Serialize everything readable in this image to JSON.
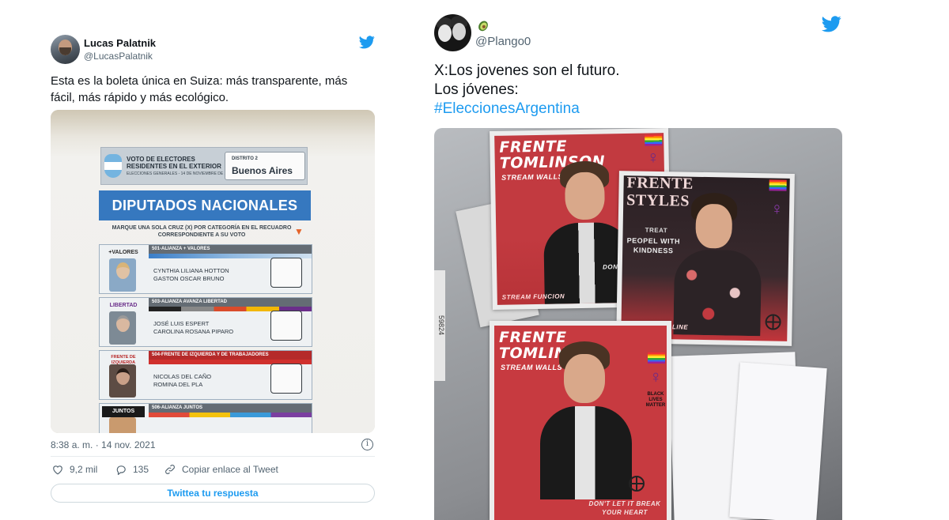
{
  "tweet_left": {
    "user_name": "Lucas Palatnik",
    "handle": "@LucasPalatnik",
    "text": "Esta es la boleta única en Suiza: más transparente, más fácil, más rápido y más ecológico.",
    "photo": {
      "header_title": "VOTO DE ELECTORES RESIDENTES EN EL EXTERIOR",
      "header_subtitle": "ELECCIONES GENERALES - 14 DE NOVIEMBRE DE 2021",
      "district_label": "DISTRITO 2",
      "district_value": "Buenos Aires",
      "banner": "DIPUTADOS NACIONALES",
      "instruction": "MARQUE UNA SOLA CRUZ (X) POR CATEGORÍA EN EL RECUADRO CORRESPONDIENTE A SU VOTO",
      "lists": [
        {
          "header": "501-ALIANZA + VALORES",
          "logo": "+VALORES",
          "cand1": "CYNTHIA LILIANA HOTTON",
          "cand2": "GASTON OSCAR BRUNO"
        },
        {
          "header": "503-ALIANZA AVANZA LIBERTAD",
          "logo": "LIBERTAD",
          "cand1": "JOSÉ LUIS ESPERT",
          "cand2": "CAROLINA ROSANA PIPARO"
        },
        {
          "header": "504-FRENTE DE IZQUIERDA Y DE TRABAJADORES",
          "logo": "FRENTE DE IZQUIERDA",
          "cand1": "NICOLAS DEL CAÑO",
          "cand2": "ROMINA DEL PLA"
        },
        {
          "header": "506-ALIANZA JUNTOS",
          "logo": "JUNTOS",
          "cand1": "",
          "cand2": ""
        }
      ]
    },
    "timestamp": "8:38 a. m. · 14 nov. 2021",
    "likes": "9,2 mil",
    "replies": "135",
    "copy_link": "Copiar enlace al Tweet",
    "reply_button": "Twittea tu respuesta",
    "colors": {
      "accent": "#1d9bf0",
      "banner": "#3678bf"
    }
  },
  "tweet_right": {
    "handle": "@Plango0",
    "line1": "X:Los jovenes son el futuro.",
    "line2": "Los jóvenes:",
    "hashtag": "#EleccionesArgentina",
    "photo": {
      "poster1_title1": "FRENTE",
      "poster1_title2": "TOMLINSON",
      "poster1_sub": "STREAM WALLS",
      "poster2_title1": "FRENTE",
      "poster2_title2": "STYLES",
      "poster2_treat": "TREAT",
      "poster2_tag": "PEOPEL WITH KINDNESS",
      "poster2_footer": "STREAM FINE LINE",
      "poster3_title1": "FRENTE",
      "poster3_title2": "TOMLINSON",
      "poster3_sub": "STREAM WALLS",
      "poster3_footer": "DON'T LET IT BREAK YOUR HEART",
      "poster3_badge": "BLACK LIVES MATTER",
      "poster1_footer": "STREAM FUNCION",
      "poster1_dont": "DON'T"
    },
    "colors": {
      "poster_red": "#c73a40",
      "poster_dark": "#2a2024"
    }
  }
}
